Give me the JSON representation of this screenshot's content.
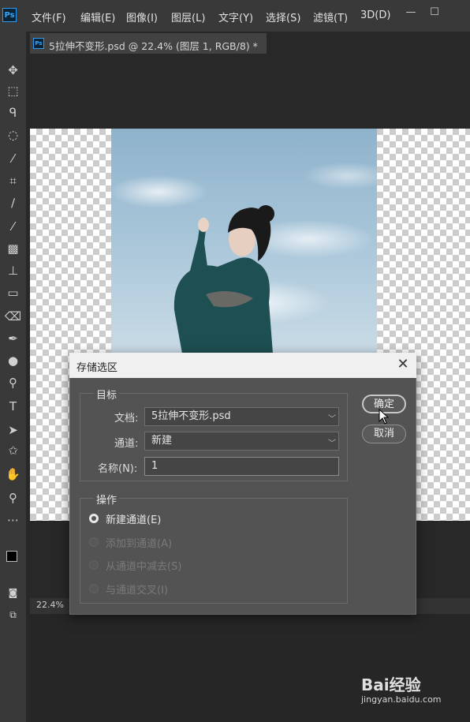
{
  "app": {
    "logo_text": "Ps"
  },
  "menu": [
    "文件(F)",
    "编辑(E)",
    "图像(I)",
    "图层(L)",
    "文字(Y)",
    "选择(S)",
    "滤镜(T)",
    "3D(D)"
  ],
  "window_controls": {
    "minimize": "—",
    "maximize": "☐"
  },
  "document_tab": {
    "title": "5拉伸不变形.psd @ 22.4% (图层 1, RGB/8) *"
  },
  "status": {
    "zoom": "22.4%"
  },
  "tools": [
    "move-tool",
    "marquee-tool",
    "lasso-tool",
    "quick-selection-tool",
    "eyedropper-tool",
    "crop-tool",
    "brush-tool",
    "healing-brush-tool",
    "clone-stamp-tool",
    "stamp-tool",
    "gradient-tool",
    "eraser-tool",
    "pen-tool",
    "blur-tool",
    "dodge-tool",
    "type-tool",
    "path-selection-tool",
    "shape-tool",
    "hand-tool",
    "zoom-tool",
    "more-tools"
  ],
  "dialog": {
    "title": "存储选区",
    "close": "✕",
    "target_group": {
      "title": "目标",
      "document_label": "文档:",
      "document_value": "5拉伸不变形.psd",
      "channel_label": "通道:",
      "channel_value": "新建",
      "name_label": "名称(N):",
      "name_value": "1"
    },
    "operation_group": {
      "title": "操作",
      "options": [
        {
          "label": "新建通道(E)",
          "selected": true,
          "enabled": true
        },
        {
          "label": "添加到通道(A)",
          "selected": false,
          "enabled": false
        },
        {
          "label": "从通道中减去(S)",
          "selected": false,
          "enabled": false
        },
        {
          "label": "与通道交叉(I)",
          "selected": false,
          "enabled": false
        }
      ]
    },
    "ok_label": "确定",
    "cancel_label": "取消"
  },
  "watermark": {
    "brand": "Bai经验",
    "url": "jingyan.baidu.com"
  }
}
